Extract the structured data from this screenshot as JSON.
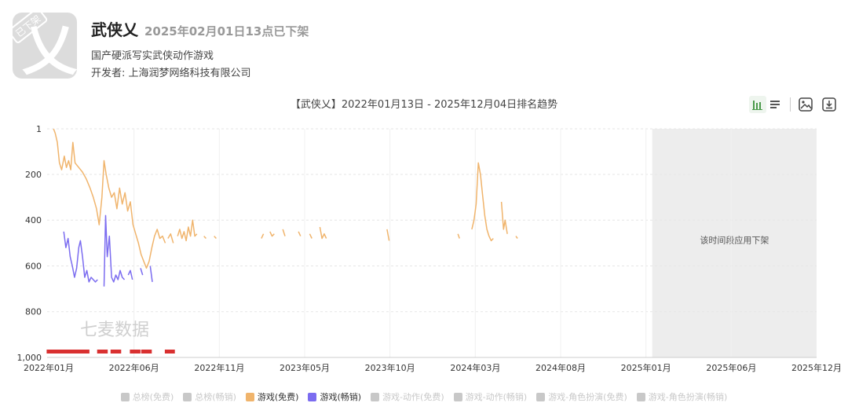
{
  "app": {
    "name": "武侠乂",
    "delist_notice": "2025年02月01日13点已下架",
    "description": "国产硬派写实武侠动作游戏",
    "developer": "开发者: 上海润梦网络科技有限公司",
    "badge": "已下架",
    "icon_glyph": "乂"
  },
  "toolbar": {
    "icons": [
      "bar-chart-icon",
      "list-icon",
      "image-icon",
      "download-icon"
    ]
  },
  "colors": {
    "free": "#f0b46c",
    "grossing": "#7b6cf0",
    "inactive": "#c8c8c8",
    "marker": "#d93030",
    "shade": "#ededed"
  },
  "chart_data": {
    "type": "line",
    "title": "【武侠乂】2022年01月13日 - 2025年12月04日排名趋势",
    "x_ticks": [
      "2022年01月",
      "2022年06月",
      "2022年11月",
      "2023年05月",
      "2023年10月",
      "2024年03月",
      "2024年08月",
      "2025年01月",
      "2025年06月",
      "2025年12月"
    ],
    "y_ticks": [
      "1",
      "200",
      "400",
      "600",
      "800",
      "1,000"
    ],
    "y_tick_values": [
      1,
      200,
      400,
      600,
      800,
      1000
    ],
    "ylim": [
      1,
      1000
    ],
    "y_inverted": true,
    "xlim": [
      "2022-01-01",
      "2025-12-04"
    ],
    "watermark": "七麦数据",
    "shaded_region": {
      "start": "2025-02-01",
      "end": "2025-12-04",
      "label": "该时间段应用下架"
    },
    "markers": [
      "2022-01-06",
      "2022-01-13",
      "2022-01-20",
      "2022-01-27",
      "2022-02-04",
      "2022-02-12",
      "2022-02-20",
      "2022-02-28",
      "2022-03-08",
      "2022-03-15",
      "2022-04-10",
      "2022-04-18",
      "2022-05-05",
      "2022-05-13",
      "2022-06-10",
      "2022-06-18",
      "2022-07-01",
      "2022-07-09",
      "2022-08-14",
      "2022-08-21"
    ],
    "series": [
      {
        "name": "游戏(免费)",
        "color": "#f0b46c",
        "active": true,
        "segments": [
          [
            [
              "2022-01-13",
              1
            ],
            [
              "2022-01-16",
              20
            ],
            [
              "2022-01-20",
              60
            ],
            [
              "2022-01-24",
              150
            ],
            [
              "2022-01-28",
              180
            ],
            [
              "2022-02-02",
              120
            ],
            [
              "2022-02-06",
              170
            ],
            [
              "2022-02-10",
              140
            ],
            [
              "2022-02-14",
              180
            ],
            [
              "2022-02-18",
              60
            ],
            [
              "2022-02-22",
              150
            ],
            [
              "2022-03-01",
              170
            ],
            [
              "2022-03-08",
              190
            ],
            [
              "2022-03-15",
              220
            ],
            [
              "2022-03-22",
              260
            ],
            [
              "2022-03-28",
              300
            ],
            [
              "2022-04-03",
              350
            ],
            [
              "2022-04-08",
              420
            ],
            [
              "2022-04-13",
              300
            ],
            [
              "2022-04-17",
              140
            ],
            [
              "2022-04-21",
              200
            ],
            [
              "2022-04-26",
              260
            ],
            [
              "2022-05-01",
              300
            ],
            [
              "2022-05-06",
              280
            ],
            [
              "2022-05-11",
              350
            ],
            [
              "2022-05-16",
              260
            ],
            [
              "2022-05-21",
              330
            ],
            [
              "2022-05-26",
              280
            ],
            [
              "2022-05-31",
              360
            ],
            [
              "2022-06-05",
              320
            ],
            [
              "2022-06-10",
              420
            ],
            [
              "2022-06-15",
              460
            ],
            [
              "2022-06-20",
              500
            ],
            [
              "2022-06-25",
              550
            ],
            [
              "2022-06-30",
              580
            ],
            [
              "2022-07-05",
              610
            ],
            [
              "2022-07-10",
              580
            ],
            [
              "2022-07-15",
              520
            ],
            [
              "2022-07-20",
              470
            ],
            [
              "2022-07-25",
              440
            ],
            [
              "2022-07-30",
              480
            ],
            [
              "2022-08-04",
              470
            ],
            [
              "2022-08-09",
              500
            ]
          ],
          [
            [
              "2022-08-14",
              480
            ],
            [
              "2022-08-19",
              460
            ],
            [
              "2022-08-24",
              500
            ]
          ],
          [
            [
              "2022-09-01",
              470
            ],
            [
              "2022-09-05",
              440
            ],
            [
              "2022-09-09",
              480
            ],
            [
              "2022-09-13",
              450
            ],
            [
              "2022-09-17",
              490
            ],
            [
              "2022-09-21",
              430
            ],
            [
              "2022-09-25",
              470
            ],
            [
              "2022-09-29",
              400
            ],
            [
              "2022-10-03",
              470
            ],
            [
              "2022-10-07",
              460
            ]
          ],
          [
            [
              "2022-10-20",
              470
            ],
            [
              "2022-10-24",
              480
            ]
          ],
          [
            [
              "2022-11-08",
              470
            ],
            [
              "2022-11-12",
              480
            ]
          ],
          [
            [
              "2023-02-04",
              480
            ],
            [
              "2023-02-08",
              460
            ]
          ],
          [
            [
              "2023-02-20",
              450
            ],
            [
              "2023-02-24",
              470
            ],
            [
              "2023-02-28",
              460
            ]
          ],
          [
            [
              "2023-03-16",
              440
            ],
            [
              "2023-03-20",
              470
            ]
          ],
          [
            [
              "2023-04-14",
              450
            ],
            [
              "2023-04-18",
              470
            ]
          ],
          [
            [
              "2023-05-05",
              460
            ],
            [
              "2023-05-09",
              480
            ]
          ],
          [
            [
              "2023-05-24",
              430
            ],
            [
              "2023-05-28",
              480
            ],
            [
              "2023-06-01",
              460
            ],
            [
              "2023-06-05",
              480
            ]
          ],
          [
            [
              "2023-09-26",
              440
            ],
            [
              "2023-09-30",
              490
            ]
          ],
          [
            [
              "2024-02-05",
              460
            ],
            [
              "2024-02-08",
              480
            ]
          ],
          [
            [
              "2024-03-02",
              440
            ],
            [
              "2024-03-06",
              400
            ],
            [
              "2024-03-10",
              330
            ],
            [
              "2024-03-14",
              150
            ],
            [
              "2024-03-18",
              200
            ],
            [
              "2024-03-22",
              290
            ],
            [
              "2024-03-26",
              380
            ],
            [
              "2024-03-30",
              440
            ],
            [
              "2024-04-03",
              470
            ],
            [
              "2024-04-07",
              490
            ],
            [
              "2024-04-11",
              480
            ]
          ],
          [
            [
              "2024-04-26",
              320
            ],
            [
              "2024-04-30",
              440
            ],
            [
              "2024-05-03",
              400
            ],
            [
              "2024-05-07",
              460
            ]
          ],
          [
            [
              "2024-05-23",
              470
            ],
            [
              "2024-05-26",
              480
            ]
          ]
        ]
      },
      {
        "name": "游戏(畅销)",
        "color": "#7b6cf0",
        "active": true,
        "segments": [
          [
            [
              "2022-02-01",
              450
            ],
            [
              "2022-02-05",
              520
            ],
            [
              "2022-02-09",
              480
            ],
            [
              "2022-02-13",
              560
            ],
            [
              "2022-02-17",
              600
            ],
            [
              "2022-02-21",
              650
            ],
            [
              "2022-02-25",
              610
            ],
            [
              "2022-03-01",
              520
            ],
            [
              "2022-03-04",
              490
            ],
            [
              "2022-03-08",
              560
            ],
            [
              "2022-03-12",
              650
            ],
            [
              "2022-03-16",
              620
            ],
            [
              "2022-03-20",
              670
            ],
            [
              "2022-03-24",
              650
            ],
            [
              "2022-03-28",
              660
            ],
            [
              "2022-04-01",
              670
            ],
            [
              "2022-04-05",
              660
            ]
          ],
          [
            [
              "2022-04-17",
              690
            ],
            [
              "2022-04-20",
              380
            ],
            [
              "2022-04-23",
              560
            ],
            [
              "2022-04-27",
              470
            ],
            [
              "2022-05-01",
              650
            ],
            [
              "2022-05-05",
              670
            ],
            [
              "2022-05-09",
              640
            ],
            [
              "2022-05-13",
              660
            ],
            [
              "2022-05-17",
              620
            ],
            [
              "2022-05-21",
              650
            ],
            [
              "2022-05-25",
              660
            ]
          ],
          [
            [
              "2022-06-01",
              640
            ],
            [
              "2022-06-05",
              620
            ],
            [
              "2022-06-09",
              660
            ]
          ],
          [
            [
              "2022-06-24",
              610
            ],
            [
              "2022-06-28",
              640
            ]
          ],
          [
            [
              "2022-07-12",
              600
            ],
            [
              "2022-07-16",
              670
            ]
          ]
        ]
      }
    ],
    "legend": [
      {
        "name": "总榜(免费)",
        "active": false
      },
      {
        "name": "总榜(畅销)",
        "active": false
      },
      {
        "name": "游戏(免费)",
        "active": true,
        "color": "#f0b46c"
      },
      {
        "name": "游戏(畅销)",
        "active": true,
        "color": "#7b6cf0"
      },
      {
        "name": "游戏-动作(免费)",
        "active": false
      },
      {
        "name": "游戏-动作(畅销)",
        "active": false
      },
      {
        "name": "游戏-角色扮演(免费)",
        "active": false
      },
      {
        "name": "游戏-角色扮演(畅销)",
        "active": false
      }
    ]
  }
}
